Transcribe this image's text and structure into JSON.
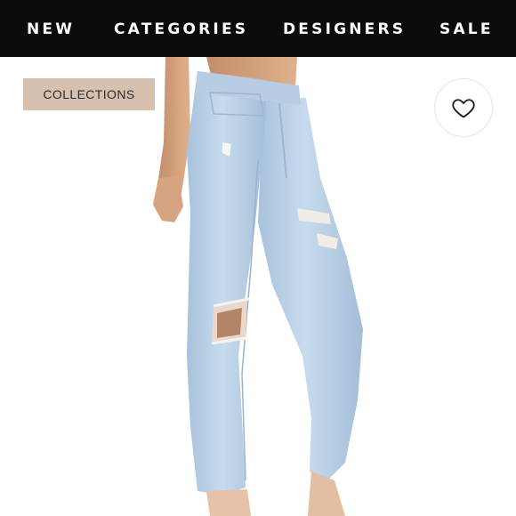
{
  "nav": {
    "items": [
      {
        "label": "NEW"
      },
      {
        "label": "CATEGORIES"
      },
      {
        "label": "DESIGNERS"
      },
      {
        "label": "SALE"
      }
    ]
  },
  "product": {
    "badge": "COLLECTIONS",
    "wishlist_icon": "heart-outline-icon"
  },
  "colors": {
    "nav_background": "#0b0b0b",
    "badge_background": "#d8c0ae",
    "denim": "#bcd3e8"
  }
}
